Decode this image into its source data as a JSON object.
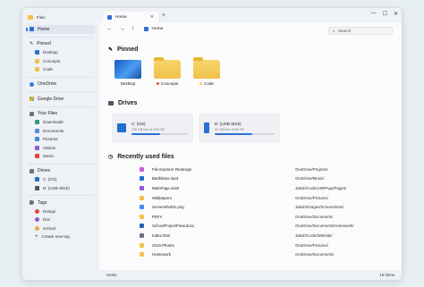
{
  "app": {
    "title": "Files"
  },
  "sidebar": {
    "home": "Home",
    "pinned_header": "Pinned",
    "pinned_items": [
      "Desktop",
      "Concepts",
      "Code"
    ],
    "onedrive": "OneDrive",
    "google_drive": "Google Drive",
    "your_files_header": "Your Files",
    "your_files": [
      "Downloads",
      "Documents",
      "Pictures",
      "Videos",
      "Music"
    ],
    "drives_header": "Drives",
    "drives": [
      "C: (OS)",
      "D: (USB Stick)"
    ],
    "tags_header": "Tags",
    "tags": [
      {
        "label": "Design",
        "color": "#e8453c"
      },
      {
        "label": "Dev",
        "color": "#8e59d6"
      },
      {
        "label": "School",
        "color": "#f2a93b"
      }
    ],
    "create_tag": "Create new tag"
  },
  "tab": {
    "label": "Home",
    "close": "✕",
    "add": "+"
  },
  "window_controls": {
    "minimize": "—",
    "maximize": "☐",
    "close": "✕"
  },
  "toolbar": {
    "back": "←",
    "forward": "→",
    "up": "↑",
    "address": "Home"
  },
  "search": {
    "placeholder": "Search"
  },
  "pinned": {
    "title": "Pinned",
    "items": [
      {
        "label": "Desktop",
        "tag_color": ""
      },
      {
        "label": "Concepts",
        "tag_color": "#e8453c"
      },
      {
        "label": "Code",
        "tag_color": "#f2c94c"
      }
    ]
  },
  "drives": {
    "title": "Drives",
    "items": [
      {
        "name": "C: (OS)",
        "detail": "235 GB free of 476 GB",
        "used_fraction": 0.51
      },
      {
        "name": "D: (USB Stick)",
        "detail": "24 GB free of 64 GB",
        "used_fraction": 0.62
      }
    ]
  },
  "recent": {
    "title": "Recently used files",
    "files": [
      {
        "name": "File Explorer Redesign",
        "path": "OneDrive/Projects/",
        "icon_color": "#c85ad8"
      },
      {
        "name": "Badtideas.mp3",
        "path": "OneDrive/Music/",
        "icon_color": "#1f6fd0"
      },
      {
        "name": "MainPage.xaml",
        "path": "Jakub/Code/UWPApp/Pages/",
        "icon_color": "#8e59d6"
      },
      {
        "name": "Wallpapers",
        "path": "OneDrive/Pictures/",
        "icon_color": "#f1c14a"
      },
      {
        "name": "Screenshot01.png",
        "path": "Jakub/Images/Screenshots/",
        "icon_color": "#3a8ee6"
      },
      {
        "name": "PDFs",
        "path": "OneDrive/Documents",
        "icon_color": "#f1c14a"
      },
      {
        "name": "SchoolProjectFinal.docx",
        "path": "OneDrive/Documents/Homework/",
        "icon_color": "#2b5fb8"
      },
      {
        "name": "Index.html",
        "path": "Jakub/Code/Website/",
        "icon_color": "#6b7280"
      },
      {
        "name": "2019 Photos",
        "path": "OneDrive/Pictures/",
        "icon_color": "#f1c14a"
      },
      {
        "name": "Homework",
        "path": "OneDrive/Documents/",
        "icon_color": "#f1c14a"
      }
    ]
  },
  "status": {
    "location": "Home",
    "count": "16 items"
  },
  "colors": {
    "accent": "#2f6fd6",
    "folder": "#f1c14a"
  }
}
